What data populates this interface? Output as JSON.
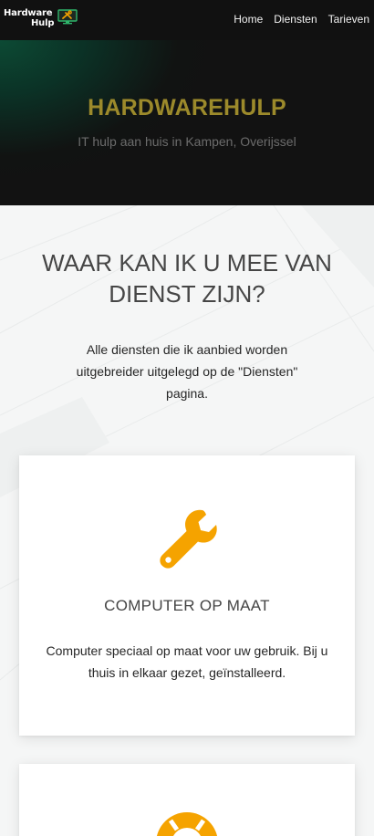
{
  "header": {
    "logo": {
      "line1": "Hardware",
      "line2": "Hulp",
      "icon": "monitor-tools-icon"
    },
    "nav": [
      {
        "label": "Home"
      },
      {
        "label": "Diensten"
      },
      {
        "label": "Tarieven"
      }
    ]
  },
  "hero": {
    "title": "HARDWAREHULP",
    "subtitle": "IT hulp aan huis in Kampen, Overijssel"
  },
  "services": {
    "heading": "WAAR KAN IK U MEE VAN DIENST ZIJN?",
    "intro": "Alle diensten die ik aanbied worden uitgebreider uitgelegd op de \"Diensten\" pagina.",
    "cards": [
      {
        "icon": "wrench-icon",
        "title": "COMPUTER OP MAAT",
        "text": "Computer speciaal op maat voor uw gebruik. Bij u thuis in elkaar gezet, geïnstalleerd."
      },
      {
        "icon": "lifebuoy-icon"
      }
    ]
  },
  "colors": {
    "navbar": "#111111",
    "hero_title": "#9c8a2b",
    "accent_icon": "#f5a300",
    "logo_green": "#2fb56b"
  }
}
